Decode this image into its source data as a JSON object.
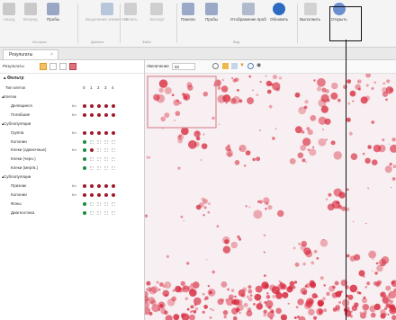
{
  "ribbon": {
    "buttons": [
      {
        "label": "Назад",
        "icon": "undo-icon",
        "dim": true
      },
      {
        "label": "Вперед",
        "icon": "redo-icon",
        "dim": true
      },
      {
        "label": "Пробы",
        "icon": "samples-icon",
        "dim": false
      },
      {
        "label": "Выделение элементов",
        "icon": "highlight-icon",
        "dim": true
      },
      {
        "label": "Печать",
        "icon": "print-icon",
        "dim": true
      },
      {
        "label": "Экспорт",
        "icon": "export-icon",
        "dim": true
      },
      {
        "label": "Панели",
        "icon": "panels-icon",
        "dim": false
      },
      {
        "label": "Пробы",
        "icon": "samples-list-icon",
        "dim": false
      },
      {
        "label": "Отображение проб",
        "icon": "display-icon",
        "dim": false
      },
      {
        "label": "Обновить",
        "icon": "refresh-icon",
        "dim": false
      },
      {
        "label": "Выполнить",
        "icon": "run-icon",
        "dim": false
      },
      {
        "label": "Открыть",
        "icon": "cloud-open-icon",
        "dim": false
      }
    ],
    "groups": [
      "История",
      "Данные",
      "Файл",
      "Вид"
    ]
  },
  "tabs": [
    {
      "label": "Результаты"
    }
  ],
  "left_panel": {
    "toolbar_label": "Результаты",
    "section_title": "Фильтр",
    "columns_label": "Тип клеток",
    "columns": [
      "0",
      "1",
      "2",
      "3",
      "4"
    ],
    "rows": [
      {
        "label": "Клетки",
        "indent": 1,
        "header": true
      },
      {
        "label": "Делящиеся",
        "indent": 2,
        "button": "Кл",
        "dots": [
          "#a0192a",
          "#a0192a",
          "#a0192a",
          "#a0192a",
          "#a0192a"
        ]
      },
      {
        "label": "Погибшие",
        "indent": 2,
        "button": "Кл",
        "dots": [
          "#a0192a",
          "#a0192a",
          "#a0192a",
          "#a0192a",
          "#a0192a"
        ]
      },
      {
        "label": "Субпопуляции",
        "indent": 1,
        "header": true
      },
      {
        "label": "Группа",
        "indent": 2,
        "button": "Кл",
        "dots": [
          "#a0192a",
          "#a0192a",
          "#a0192a",
          "#a0192a",
          "#a0192a"
        ]
      },
      {
        "label": "Колонии",
        "indent": 2,
        "button": "",
        "dots": [
          "#1a8a3a",
          "",
          "",
          "",
          ""
        ]
      },
      {
        "label": "Клеки (одиночные)",
        "indent": 2,
        "button": "Кл",
        "dots": [
          "#1a8a3a",
          "#a0192a",
          "",
          "",
          ""
        ]
      },
      {
        "label": "Клеки (черн.)",
        "indent": 2,
        "button": "",
        "dots": [
          "#1a8a3a",
          "",
          "",
          "",
          ""
        ]
      },
      {
        "label": "Клеки (мертв.)",
        "indent": 2,
        "button": "",
        "dots": [
          "#1a8a3a",
          "",
          "",
          "",
          ""
        ]
      },
      {
        "label": "Субпопуляции",
        "indent": 1,
        "header": true
      },
      {
        "label": "Признак",
        "indent": 2,
        "button": "Кл",
        "dots": [
          "#a0192a",
          "#a0192a",
          "#a0192a",
          "#a0192a",
          "#a0192a"
        ]
      },
      {
        "label": "Колонии",
        "indent": 2,
        "button": "Кл",
        "dots": [
          "#a0192a",
          "#a0192a",
          "#a0192a",
          "#a0192a",
          "#a0192a"
        ]
      },
      {
        "label": "Фоны",
        "indent": 2,
        "button": "",
        "dots": [
          "#1a8a3a",
          "",
          "",
          "",
          ""
        ]
      },
      {
        "label": "Диагностика",
        "indent": 2,
        "button": "",
        "dots": [
          "#1a8a3a",
          "",
          "",
          "",
          ""
        ]
      }
    ]
  },
  "viewer": {
    "scale_label": "Увеличение",
    "scale_value": "50"
  },
  "colors": {
    "accent": "#a0192a",
    "green": "#1a8a3a",
    "stain": "#d8283c"
  }
}
